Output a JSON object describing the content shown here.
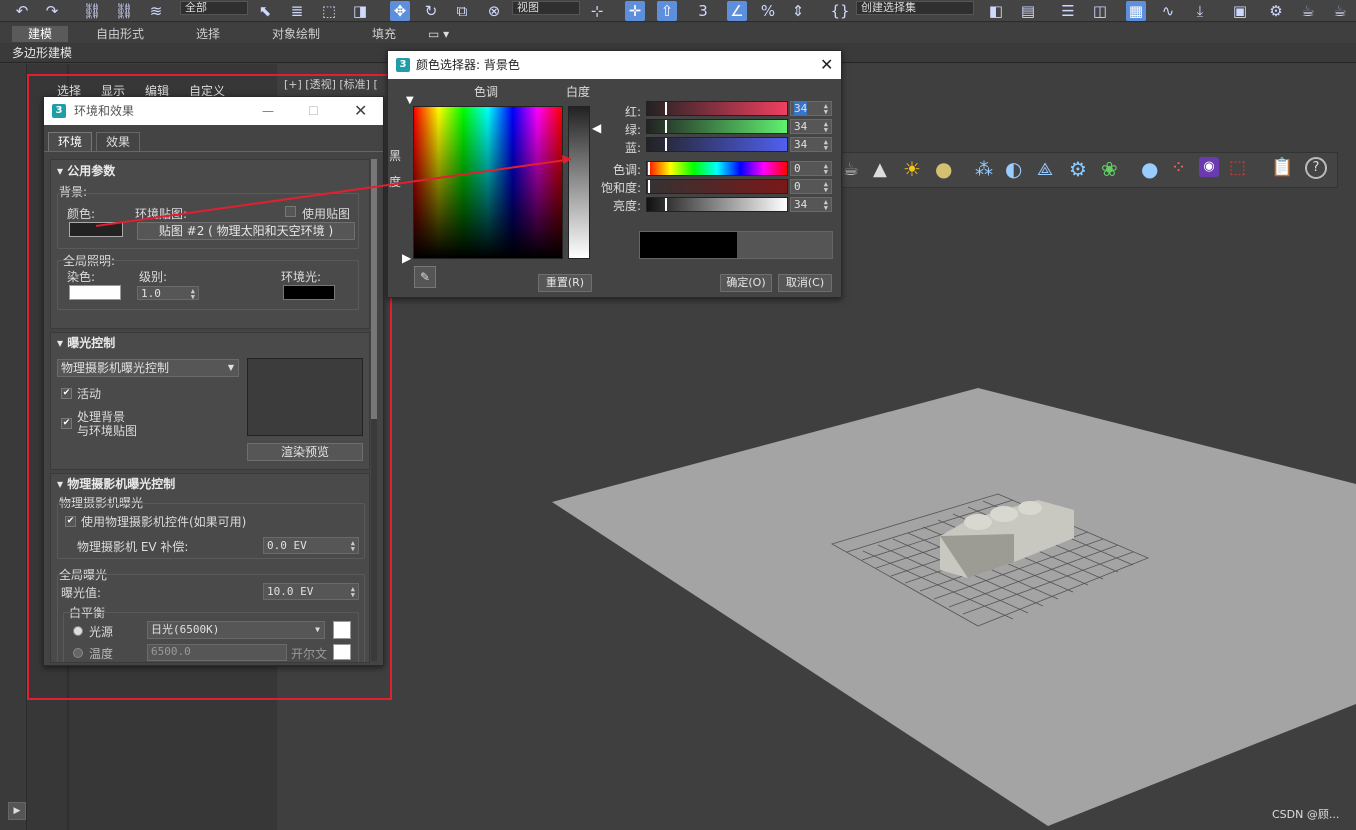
{
  "toolbar": {
    "selection_filter": "全部",
    "view_dropdown": "视图",
    "named_set": "创建选择集"
  },
  "ribbon": {
    "tabs": [
      "建模",
      "自由形式",
      "选择",
      "对象绘制",
      "填充"
    ],
    "subtab": "多边形建模"
  },
  "viewport": {
    "label": "[+] [透视] [标准] [",
    "watermark": "CSDN @顾..."
  },
  "cmdpanel": {
    "menu": [
      "选择",
      "显示",
      "编辑",
      "自定义"
    ]
  },
  "env": {
    "title": "环境和效果",
    "tabs": [
      "环境",
      "效果"
    ],
    "common": {
      "header": "公用参数",
      "bg_label": "背景:",
      "color_label": "颜色:",
      "envmap_label": "环境贴图:",
      "use_map_label": "使用贴图",
      "map_button": "贴图 #2  ( 物理太阳和天空环境 )",
      "gi_label": "全局照明:",
      "tint_label": "染色:",
      "level_label": "级别:",
      "level_value": "1.0",
      "ambient_label": "环境光:"
    },
    "exposure": {
      "header": "曝光控制",
      "dropdown": "物理摄影机曝光控制",
      "active_label": "活动",
      "process_bg_line1": "处理背景",
      "process_bg_line2": "与环境贴图",
      "render_preview": "渲染预览"
    },
    "phys": {
      "header": "物理摄影机曝光控制",
      "group_label": "物理摄影机曝光",
      "use_ctrl_label": "使用物理摄影机控件(如果可用)",
      "ev_label": "物理摄影机 EV 补偿:",
      "ev_value": "0.0 EV",
      "global_label": "全局曝光",
      "exposure_label": "曝光值:",
      "exposure_value": "10.0 EV",
      "wb_label": "白平衡",
      "light_label": "光源",
      "light_value": "日光(6500K)",
      "temp_label": "温度",
      "temp_value": "6500.0",
      "kelvin_label": "开尔文"
    }
  },
  "picker": {
    "title": "颜色选择器: 背景色",
    "hue_label": "色调",
    "white_label": "白度",
    "black_label": "黑",
    "degree_label": "度",
    "rows": [
      {
        "label": "红:",
        "value": "34"
      },
      {
        "label": "绿:",
        "value": "34"
      },
      {
        "label": "蓝:",
        "value": "34"
      },
      {
        "label": "色调:",
        "value": "0"
      },
      {
        "label": "饱和度:",
        "value": "0"
      },
      {
        "label": "亮度:",
        "value": "34"
      }
    ],
    "reset": "重置(R)",
    "ok": "确定(O)",
    "cancel": "取消(C)"
  },
  "colors": {
    "highlight": "#e02030",
    "accent": "#5d8fdc",
    "swatch_current": "#222222"
  }
}
